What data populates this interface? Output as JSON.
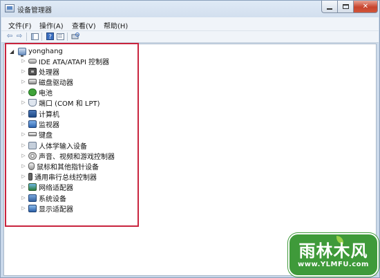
{
  "window": {
    "title": "设备管理器",
    "controls": {
      "close": "✕"
    }
  },
  "menubar": {
    "items": [
      "文件(F)",
      "操作(A)",
      "查看(V)",
      "帮助(H)"
    ]
  },
  "toolbar": {
    "back": "⇦",
    "forward": "⇨"
  },
  "tree": {
    "root": {
      "label": "yonghang",
      "expander": "◢"
    },
    "collapsed_glyph": "▷",
    "items": [
      {
        "label": "IDE ATA/ATAPI 控制器",
        "icon": "ide-controller-icon"
      },
      {
        "label": "处理器",
        "icon": "processor-icon"
      },
      {
        "label": "磁盘驱动器",
        "icon": "disk-drive-icon"
      },
      {
        "label": "电池",
        "icon": "battery-icon"
      },
      {
        "label": "端口 (COM 和 LPT)",
        "icon": "port-icon"
      },
      {
        "label": "计算机",
        "icon": "computer-icon"
      },
      {
        "label": "监视器",
        "icon": "monitor-icon"
      },
      {
        "label": "键盘",
        "icon": "keyboard-icon"
      },
      {
        "label": "人体学输入设备",
        "icon": "hid-icon"
      },
      {
        "label": "声音、视频和游戏控制器",
        "icon": "sound-icon"
      },
      {
        "label": "鼠标和其他指针设备",
        "icon": "mouse-icon"
      },
      {
        "label": "通用串行总线控制器",
        "icon": "usb-icon"
      },
      {
        "label": "网络适配器",
        "icon": "network-adapter-icon"
      },
      {
        "label": "系统设备",
        "icon": "system-device-icon"
      },
      {
        "label": "显示适配器",
        "icon": "display-adapter-icon"
      }
    ]
  },
  "highlight_color": "#c8233d",
  "watermark": {
    "title": "雨林木风",
    "url": "www.YLMFU.com",
    "color": "#3f9a3a"
  }
}
